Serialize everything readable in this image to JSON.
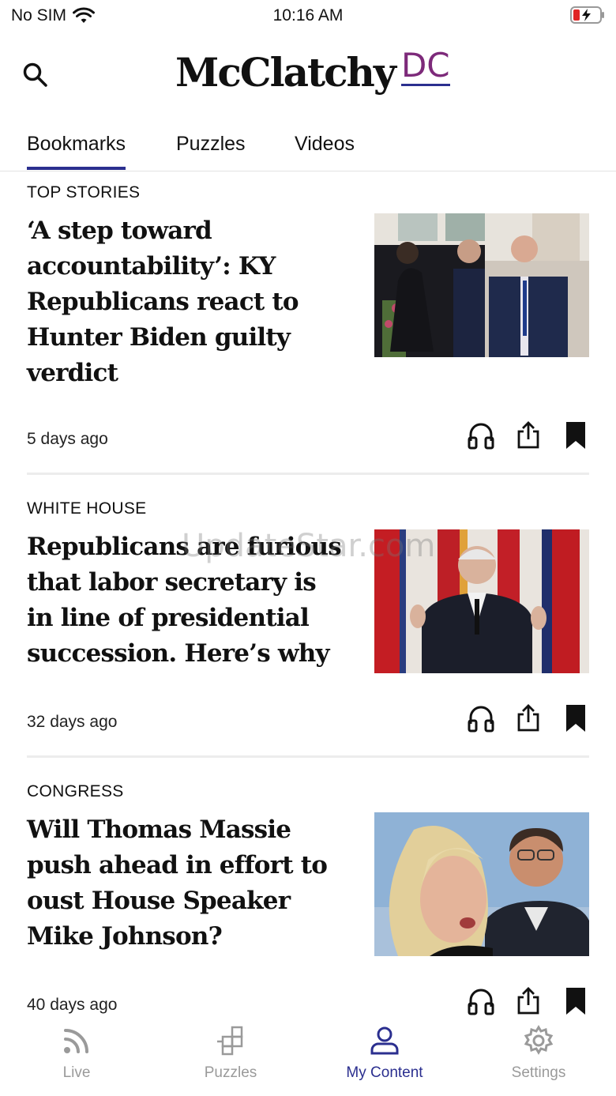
{
  "status": {
    "carrier": "No SIM",
    "time": "10:16 AM"
  },
  "header": {
    "logo_main": "McClatchy",
    "logo_suffix": "DC"
  },
  "tabs": [
    {
      "label": "Bookmarks",
      "active": true
    },
    {
      "label": "Puzzles",
      "active": false
    },
    {
      "label": "Videos",
      "active": false
    }
  ],
  "articles": [
    {
      "section": "TOP STORIES",
      "headline": "‘A step toward accountability’: KY Republicans react to Hunter Biden guilty verdict",
      "time_ago": "5 days ago"
    },
    {
      "section": "WHITE HOUSE",
      "headline": "Republicans are furious that labor secretary is in line of presidential succession. Here’s why",
      "time_ago": "32 days ago"
    },
    {
      "section": "CONGRESS",
      "headline": "Will Thomas Massie push ahead in effort to oust House Speaker Mike Johnson?",
      "time_ago": "40 days ago"
    }
  ],
  "watermark": "UpdateStar.com",
  "bottom_nav": [
    {
      "label": "Live",
      "icon": "rss-icon"
    },
    {
      "label": "Puzzles",
      "icon": "puzzle-icon"
    },
    {
      "label": "My Content",
      "icon": "person-icon",
      "active": true
    },
    {
      "label": "Settings",
      "icon": "gear-icon"
    }
  ],
  "colors": {
    "accent": "#2b2f8f",
    "logo_dc": "#7d2a7a",
    "inactive_nav": "#9a9a9a"
  }
}
